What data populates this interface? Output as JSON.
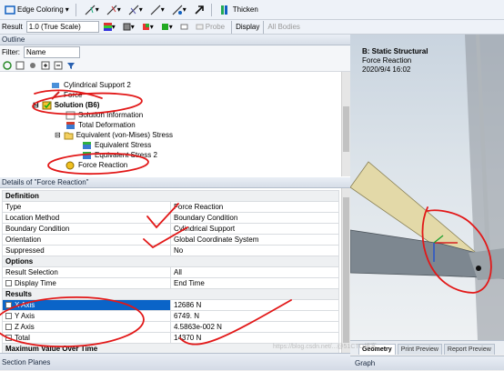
{
  "toolbar1": {
    "edge_coloring": "Edge Coloring",
    "thicken": "Thicken"
  },
  "toolbar2": {
    "result_label": "Result",
    "result_scale": "1.0 (True Scale)",
    "probe": "Probe",
    "display": "Display",
    "all_bodies": "All Bodies"
  },
  "outline": {
    "title": "Outline",
    "filter_label": "Filter:",
    "filter_value": "Name",
    "tree": [
      "Cylindrical Support 2",
      "Force",
      "Solution (B6)",
      "Solution Information",
      "Total Deformation",
      "Equivalent (von-Mises) Stress",
      "Equivalent Stress",
      "Equivalent Stress 2",
      "Force Reaction"
    ]
  },
  "details": {
    "title": "Details of \"Force Reaction\"",
    "sections": {
      "definition": "Definition",
      "options": "Options",
      "results": "Results",
      "maximum": "Maximum Value Over Time"
    },
    "rows": {
      "type": [
        "Type",
        "Force Reaction"
      ],
      "location_method": [
        "Location Method",
        "Boundary Condition"
      ],
      "boundary_condition": [
        "Boundary Condition",
        "Cylindrical Support"
      ],
      "orientation": [
        "Orientation",
        "Global Coordinate System"
      ],
      "suppressed": [
        "Suppressed",
        "No"
      ],
      "result_selection": [
        "Result Selection",
        "All"
      ],
      "display_time": [
        "Display Time",
        "End Time"
      ],
      "x_axis": [
        "X Axis",
        "12686 N"
      ],
      "y_axis": [
        "Y Axis",
        "6749. N"
      ],
      "z_axis": [
        "Z Axis",
        "4.5863e-002 N"
      ],
      "total": [
        "Total",
        "14370 N"
      ]
    }
  },
  "section_planes": "Section Planes",
  "viewport": {
    "analysis": "B: Static Structural",
    "result": "Force Reaction",
    "timestamp": "2020/9/4 16:02"
  },
  "viewtabs": [
    "Geometry",
    "Print Preview",
    "Report Preview"
  ],
  "graph": "Graph",
  "watermark": "https://blog.csdn.net/...@51CTO博客"
}
